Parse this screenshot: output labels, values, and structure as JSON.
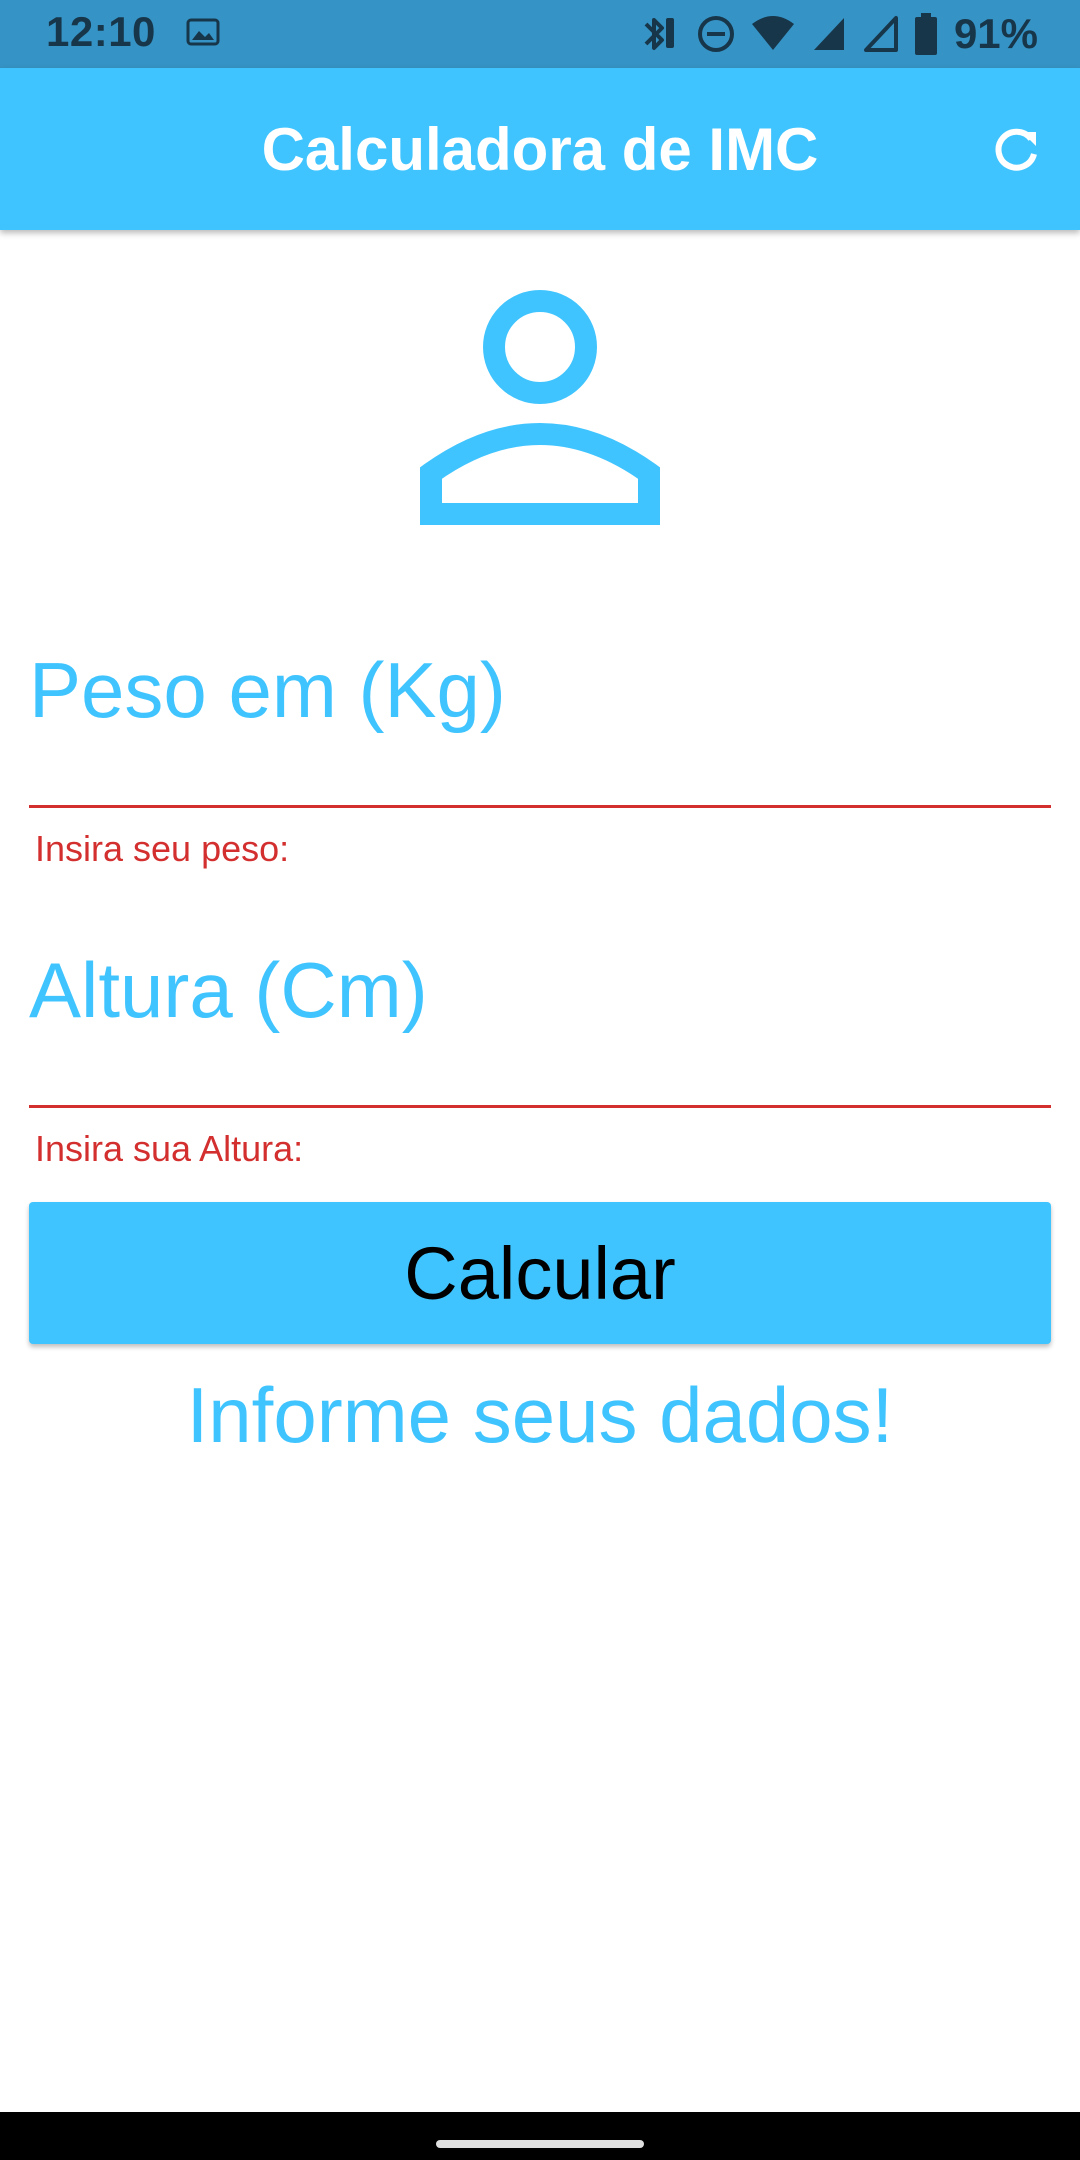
{
  "status_bar": {
    "time": "12:10",
    "battery": "91%",
    "icons": [
      "gallery-icon",
      "bluetooth-icon",
      "dnd-icon",
      "wifi-icon",
      "signal-icon",
      "signal-icon",
      "battery-icon"
    ]
  },
  "app_bar": {
    "title": "Calculadora de IMC",
    "refresh_icon": "refresh-icon",
    "background": "#40c4ff"
  },
  "form": {
    "weight": {
      "label": "Peso em (Kg)",
      "value": "",
      "error": "Insira seu peso:"
    },
    "height": {
      "label": "Altura (Cm)",
      "value": "",
      "error": "Insira sua Altura:"
    },
    "calculate_label": "Calcular",
    "info_text": "Informe seus dados!"
  },
  "colors": {
    "accent": "#40c4ff",
    "error": "#d32f2f",
    "status_bar": "#3693c5"
  }
}
